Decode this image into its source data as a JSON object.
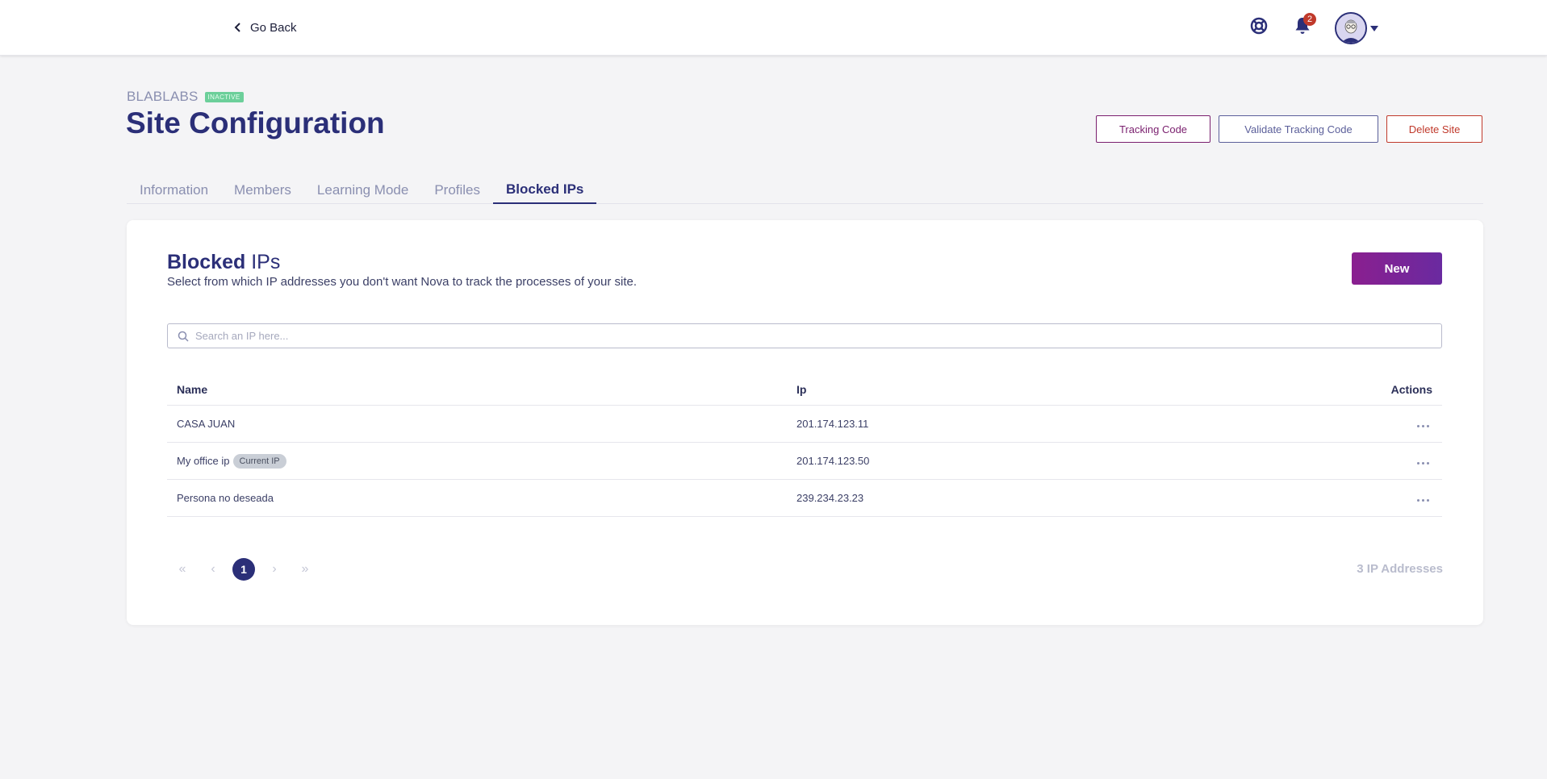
{
  "topbar": {
    "go_back_label": "Go Back",
    "notifications_count": "2"
  },
  "header": {
    "site_name": "BLABLABS",
    "status": "INACTIVE",
    "title": "Site Configuration",
    "actions": {
      "tracking_code": "Tracking Code",
      "validate_tracking_code": "Validate Tracking Code",
      "delete_site": "Delete Site"
    }
  },
  "tabs": [
    {
      "label": "Information"
    },
    {
      "label": "Members"
    },
    {
      "label": "Learning Mode"
    },
    {
      "label": "Profiles"
    },
    {
      "label": "Blocked IPs",
      "active": true
    }
  ],
  "card": {
    "title_bold": "Blocked",
    "title_light": "IPs",
    "subtitle": "Select from which IP addresses you don't want Nova to track the processes of your site.",
    "new_button": "New",
    "search": {
      "placeholder": "Search an IP here..."
    },
    "table": {
      "columns": {
        "name": "Name",
        "ip": "Ip",
        "actions": "Actions"
      },
      "rows": [
        {
          "name": "CASA JUAN",
          "badge": "",
          "ip": "201.174.123.11"
        },
        {
          "name": "My office ip",
          "badge": "Current IP",
          "ip": "201.174.123.50"
        },
        {
          "name": "Persona no deseada",
          "badge": "",
          "ip": "239.234.23.23"
        }
      ]
    },
    "pagination": {
      "first": "«",
      "prev": "‹",
      "current_page": "1",
      "next": "›",
      "last": "»"
    },
    "count_label": "3 IP Addresses"
  },
  "colors": {
    "primary": "#2b2f78",
    "accent_purple": "#8a1f8f",
    "danger": "#c0392b",
    "status_badge": "#6ccf9a"
  },
  "icons": {
    "back": "chevron-left-icon",
    "help": "lifebuoy-icon",
    "notifications": "bell-icon",
    "search": "search-icon",
    "row_actions": "more-horizontal-icon"
  }
}
